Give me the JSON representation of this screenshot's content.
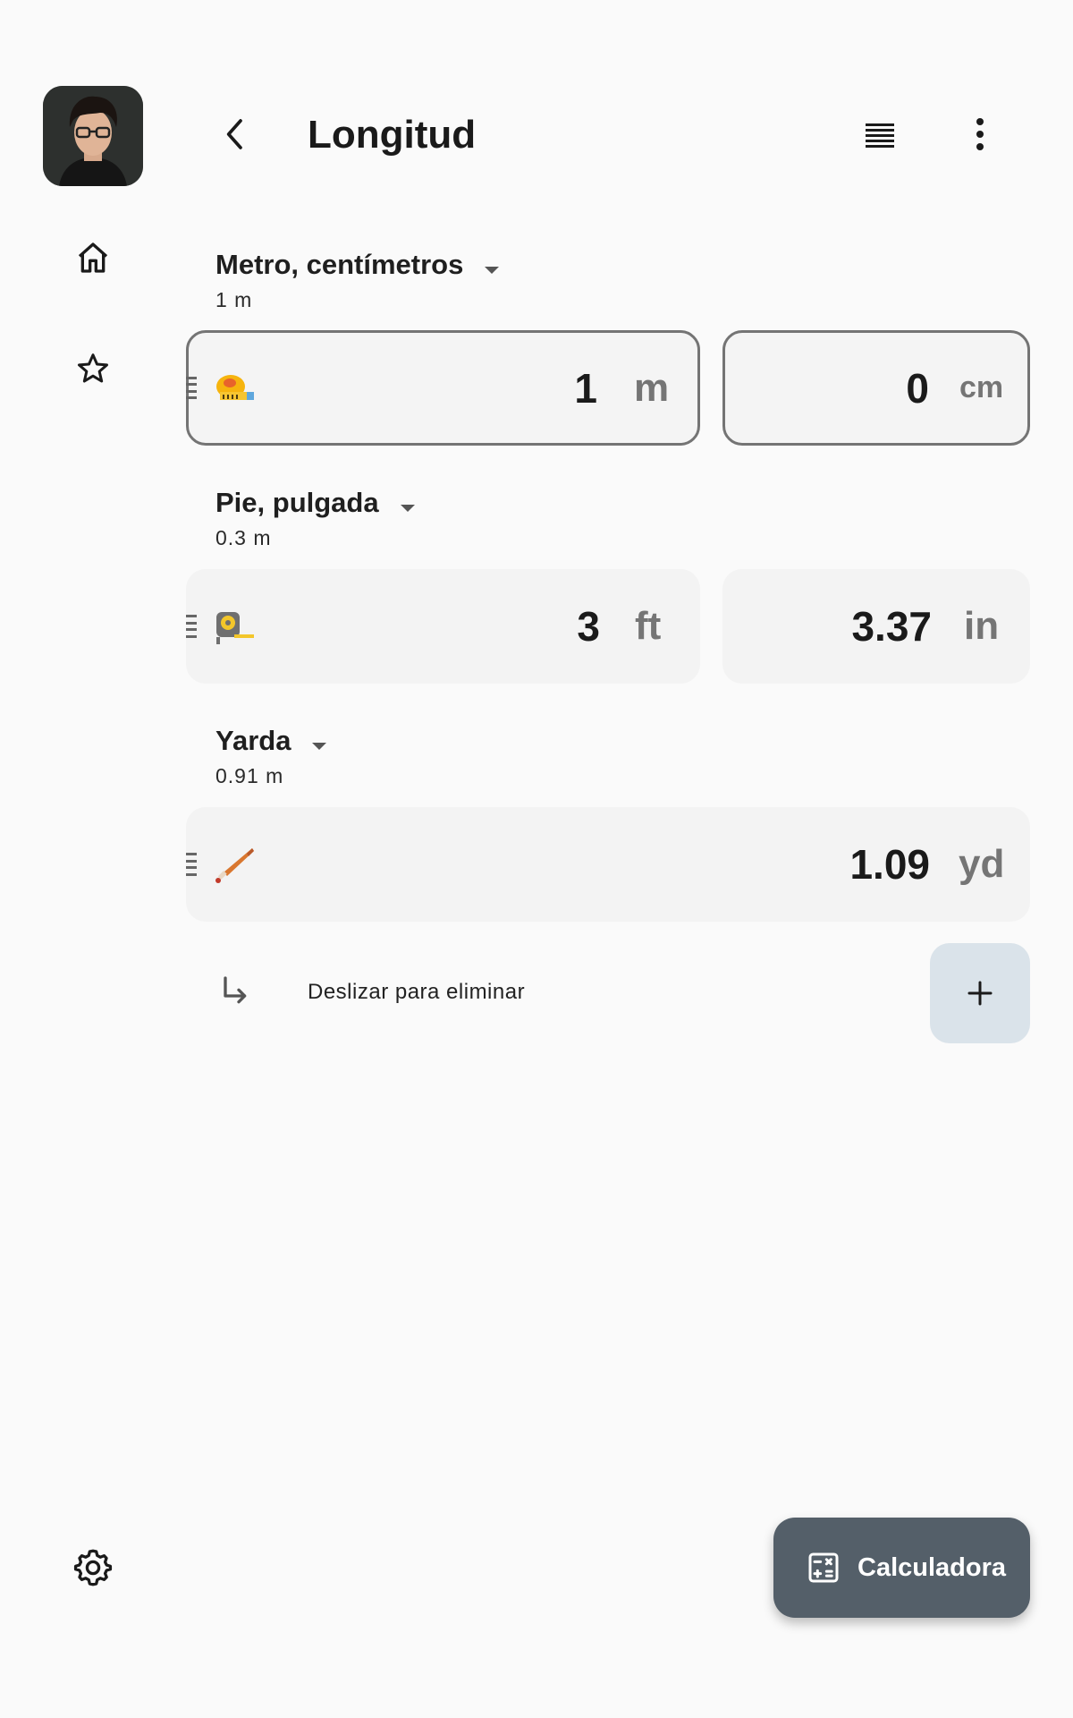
{
  "header": {
    "title": "Longitud"
  },
  "rows": [
    {
      "name": "Metro, centímetros",
      "subtitle": "1 m",
      "primary": {
        "value": "1",
        "unit": "m"
      },
      "secondary": {
        "value": "0",
        "unit": "cm"
      },
      "icon": "measuring-tape-icon"
    },
    {
      "name": "Pie, pulgada",
      "subtitle": "0.3 m",
      "primary": {
        "value": "3",
        "unit": "ft"
      },
      "secondary": {
        "value": "3.37",
        "unit": "in"
      },
      "icon": "tape-measure-icon"
    },
    {
      "name": "Yarda",
      "subtitle": "0.91 m",
      "primary": {
        "value": "1.09",
        "unit": "yd"
      },
      "icon": "baseball-bat-icon"
    }
  ],
  "hint": {
    "text": "Deslizar para eliminar"
  },
  "fab": {
    "label": "Calculadora"
  },
  "colors": {
    "background": "#fafafa",
    "fab": "#545f69",
    "add_button": "#dae3ea",
    "outline": "#747474"
  }
}
